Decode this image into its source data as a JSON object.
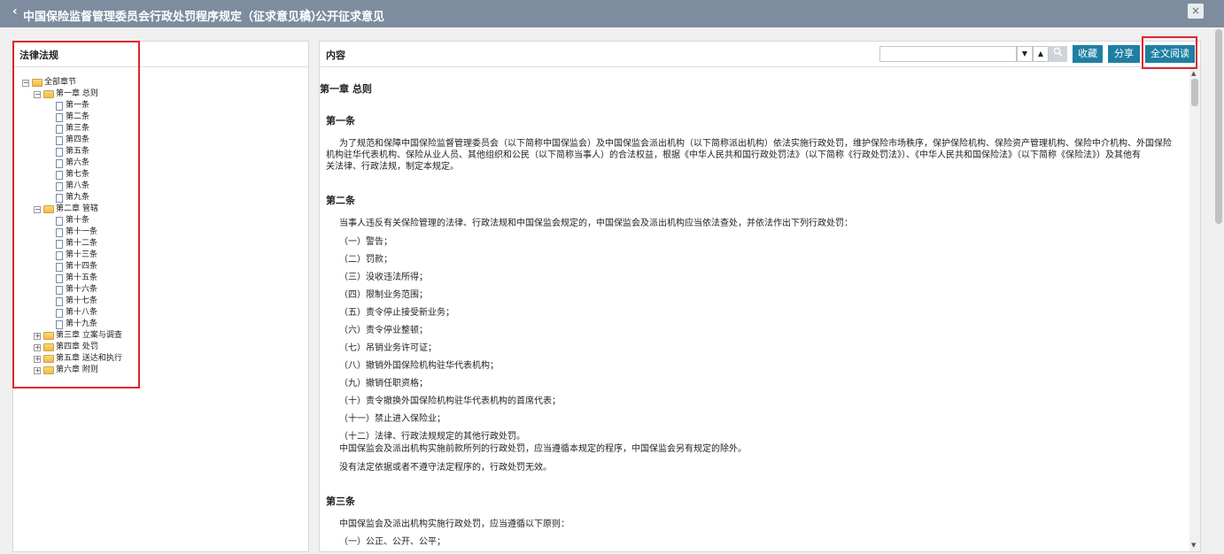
{
  "header": {
    "back_arrow": "‹",
    "breadcrumb_1": "中国保险监督管理委员会行政处罚程序规定（征求意见稿）",
    "separator": "›",
    "breadcrumb_2": "公开征求意见",
    "close": "×"
  },
  "left_panel": {
    "title": "法律法规",
    "tree": {
      "root": "全部章节",
      "chapter1": "第一章 总则",
      "ch1_items": [
        "第一条",
        "第二条",
        "第三条",
        "第四条",
        "第五条",
        "第六条",
        "第七条",
        "第八条",
        "第九条"
      ],
      "chapter2": "第二章 管辖",
      "ch2_items": [
        "第十条",
        "第十一条",
        "第十二条",
        "第十三条",
        "第十四条",
        "第十五条",
        "第十六条",
        "第十七条",
        "第十八条",
        "第十九条"
      ],
      "chapter3": "第三章 立案与调查",
      "chapter4": "第四章 处罚",
      "chapter5": "第五章 送达和执行",
      "chapter6": "第六章 附则"
    }
  },
  "right_panel": {
    "title": "内容",
    "search_placeholder": "",
    "buttons": {
      "collect": "收藏",
      "share": "分享",
      "full_read": "全文阅读"
    },
    "content": {
      "chapter_heading": "第一章 总则",
      "article1_title": "第一条",
      "article1_text_1": "为了规范和保障中国保险监督管理委员会（以下简称中国保监会）及中国保监会派出机构（以下简称派出机构）依法实施行政处罚，维护保险市场秩序，保护保险机构、保险资产管理机构、保险中介机构、外国保险",
      "article1_text_2": "机构驻华代表机构、保险从业人员、其他组织和公民（以下简称当事人）的合法权益，根据《中华人民共和国行政处罚法》（以下简称《行政处罚法》）、《中华人民共和国保险法》（以下简称《保险法》）及其他有",
      "article1_text_3": "关法律、行政法规，制定本规定。",
      "article2_title": "第二条",
      "article2_intro": "当事人违反有关保险管理的法律、行政法规和中国保监会规定的，中国保监会及派出机构应当依法查处，并依法作出下列行政处罚：",
      "article2_items": [
        "（一）警告；",
        "（二）罚款；",
        "（三）没收违法所得；",
        "（四）限制业务范围；",
        "（五）责令停止接受新业务；",
        "（六）责令停业整顿；",
        "（七）吊销业务许可证；",
        "（八）撤销外国保险机构驻华代表机构；",
        "（九）撤销任职资格；",
        "（十）责令撤换外国保险机构驻华代表机构的首席代表；",
        "（十一）禁止进入保险业；",
        "（十二）法律、行政法规规定的其他行政处罚。"
      ],
      "article2_tail_1": "中国保监会及派出机构实施前款所列的行政处罚，应当遵循本规定的程序，中国保监会另有规定的除外。",
      "article2_tail_2": "没有法定依据或者不遵守法定程序的，行政处罚无效。",
      "article3_title": "第三条",
      "article3_intro": "中国保监会及派出机构实施行政处罚，应当遵循以下原则：",
      "article3_item1": "（一）公正、公开、公平；"
    }
  },
  "icons": {
    "search": "search-icon",
    "dropdown": "chevron-down-icon",
    "up": "chevron-up-icon",
    "folder": "folder-icon",
    "doc": "document-icon",
    "close": "close-icon"
  },
  "colors": {
    "titlebar": "#7d8d9f",
    "button": "#1e7fa3",
    "highlight": "#e0242b"
  }
}
